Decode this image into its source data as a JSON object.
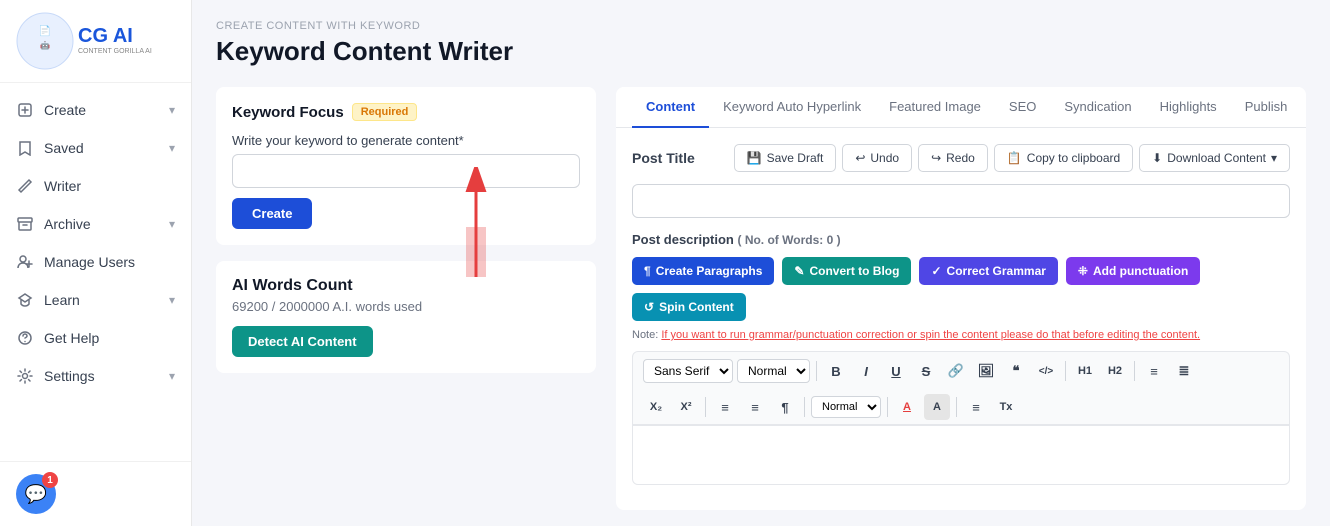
{
  "sidebar": {
    "logo_text": "CG AI",
    "logo_sub": "CONTENT GORILLA AI",
    "nav_items": [
      {
        "id": "create",
        "label": "Create",
        "has_chevron": true,
        "icon": "✦"
      },
      {
        "id": "saved",
        "label": "Saved",
        "has_chevron": true,
        "icon": "🔖"
      },
      {
        "id": "writer",
        "label": "Writer",
        "has_chevron": false,
        "icon": "✏️"
      },
      {
        "id": "archive",
        "label": "Archive",
        "has_chevron": true,
        "icon": "📁"
      },
      {
        "id": "manage-users",
        "label": "Manage Users",
        "has_chevron": false,
        "icon": "👥"
      },
      {
        "id": "learn",
        "label": "Learn",
        "has_chevron": true,
        "icon": "🎓"
      },
      {
        "id": "get-help",
        "label": "Get Help",
        "has_chevron": false,
        "icon": "❓"
      },
      {
        "id": "settings",
        "label": "Settings",
        "has_chevron": true,
        "icon": "⚙️"
      }
    ],
    "chat_badge": "1"
  },
  "breadcrumb": "CREATE CONTENT WITH KEYWORD",
  "page_title": "Keyword Content Writer",
  "keyword_focus": {
    "label": "Keyword Focus",
    "required_badge": "Required",
    "input_label": "Write your keyword to generate content*",
    "input_placeholder": "",
    "create_button": "Create"
  },
  "ai_words": {
    "title": "AI Words Count",
    "count_text": "69200 / 2000000 A.I. words used",
    "detect_button": "Detect AI Content"
  },
  "tabs": [
    {
      "id": "content",
      "label": "Content",
      "active": true
    },
    {
      "id": "keyword-auto",
      "label": "Keyword Auto Hyperlink",
      "active": false
    },
    {
      "id": "featured-image",
      "label": "Featured Image",
      "active": false
    },
    {
      "id": "seo",
      "label": "SEO",
      "active": false
    },
    {
      "id": "syndication",
      "label": "Syndication",
      "active": false
    },
    {
      "id": "highlights",
      "label": "Highlights",
      "active": false
    },
    {
      "id": "publish",
      "label": "Publish",
      "active": false
    }
  ],
  "editor": {
    "post_title_label": "Post Title",
    "save_draft_btn": "Save Draft",
    "undo_btn": "Undo",
    "redo_btn": "Redo",
    "copy_btn": "Copy to clipboard",
    "download_btn": "Download Content",
    "post_desc_label": "Post description",
    "word_count_label": "( No. of Words: 0 )",
    "create_paragraphs_btn": "Create Paragraphs",
    "convert_blog_btn": "Convert to Blog",
    "correct_grammar_btn": "Correct Grammar",
    "add_punctuation_btn": "Add punctuation",
    "spin_content_btn": "Spin Content",
    "note_label": "Note:",
    "note_text": "If you want to run grammar/punctuation correction or spin the content please do that before editing the content.",
    "toolbar": {
      "font": "Sans Serif",
      "size": "Normal",
      "bold": "B",
      "italic": "I",
      "underline": "U",
      "strikethrough": "S",
      "link": "🔗",
      "image": "🖼",
      "quote": "❝",
      "code": "</>",
      "h1": "H1",
      "h2": "H2",
      "list_ul": "≡",
      "list_ol": "≣",
      "sub": "X₂",
      "sup": "X²",
      "align_left": "≡",
      "align_right": "≡",
      "paragraph": "¶",
      "color": "A",
      "bg_color": "A",
      "align_center": "≡",
      "clear": "Tx"
    }
  }
}
